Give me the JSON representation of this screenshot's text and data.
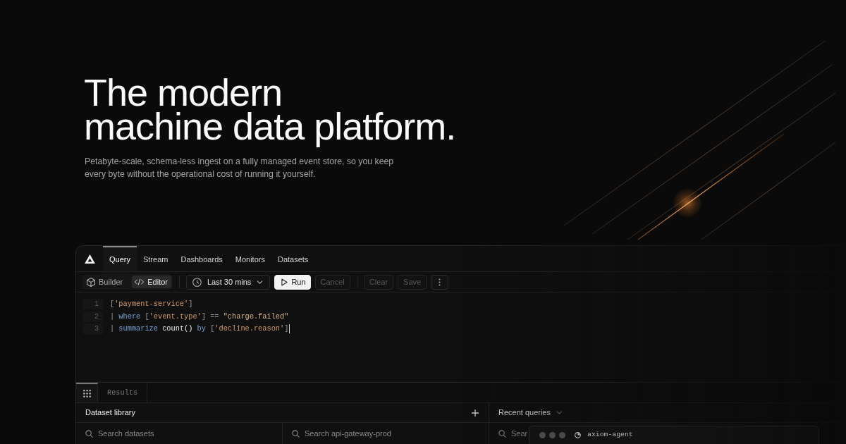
{
  "hero": {
    "title": "The modern\nmachine data platform.",
    "subtitle": "Petabyte-scale, schema-less ingest on a fully managed event store, so you keep every byte without the operational cost of running it yourself."
  },
  "app": {
    "nav_tabs": [
      {
        "label": "Query",
        "selected": true
      },
      {
        "label": "Stream",
        "selected": false
      },
      {
        "label": "Dashboards",
        "selected": false
      },
      {
        "label": "Monitors",
        "selected": false
      },
      {
        "label": "Datasets",
        "selected": false
      }
    ],
    "modes": [
      {
        "kind": "builder",
        "label": "Builder",
        "selected": false
      },
      {
        "kind": "editor",
        "label": "Editor",
        "selected": true
      }
    ],
    "time_range": {
      "label": "Last 30 mins"
    },
    "action_groups": [
      [
        {
          "kind": "run",
          "label": "Run",
          "disabled": false
        },
        {
          "kind": "plain",
          "label": "Cancel",
          "disabled": true
        }
      ],
      [
        {
          "kind": "plain",
          "label": "Clear",
          "disabled": true
        },
        {
          "kind": "plain",
          "label": "Save",
          "disabled": true
        }
      ]
    ],
    "editor": {
      "lines": [
        {
          "number": "1",
          "cursor": false,
          "tokens": [
            {
              "kind": "punct",
              "text": "["
            },
            {
              "kind": "string",
              "text": "'payment-service'"
            },
            {
              "kind": "punct",
              "text": "]"
            }
          ]
        },
        {
          "number": "2",
          "cursor": false,
          "tokens": [
            {
              "kind": "punct",
              "text": "| "
            },
            {
              "kind": "keyword",
              "text": "where"
            },
            {
              "kind": "punct",
              "text": " ["
            },
            {
              "kind": "string",
              "text": "'event.type'"
            },
            {
              "kind": "punct",
              "text": "] == "
            },
            {
              "kind": "literal",
              "text": "\"charge.failed\""
            }
          ]
        },
        {
          "number": "3",
          "cursor": true,
          "tokens": [
            {
              "kind": "punct",
              "text": "| "
            },
            {
              "kind": "keyword",
              "text": "summarize"
            },
            {
              "kind": "plain",
              "text": " count() "
            },
            {
              "kind": "keyword",
              "text": "by"
            },
            {
              "kind": "punct",
              "text": " ["
            },
            {
              "kind": "string",
              "text": "'decline.reason'"
            },
            {
              "kind": "punct",
              "text": "]"
            }
          ]
        }
      ]
    },
    "bottom_tabs": [
      {
        "kind": "grid",
        "selected": true
      },
      {
        "kind": "text",
        "label": "Results",
        "selected": false
      }
    ],
    "dataset_panel": {
      "title": "Dataset library",
      "searches": [
        {
          "placeholder": "Search datasets"
        },
        {
          "placeholder": "Search api-gateway-prod"
        }
      ]
    },
    "recent_panel": {
      "title": "Recent queries",
      "search": {
        "placeholder": "Sear"
      }
    }
  },
  "agent_window": {
    "title": "axiom-agent"
  }
}
